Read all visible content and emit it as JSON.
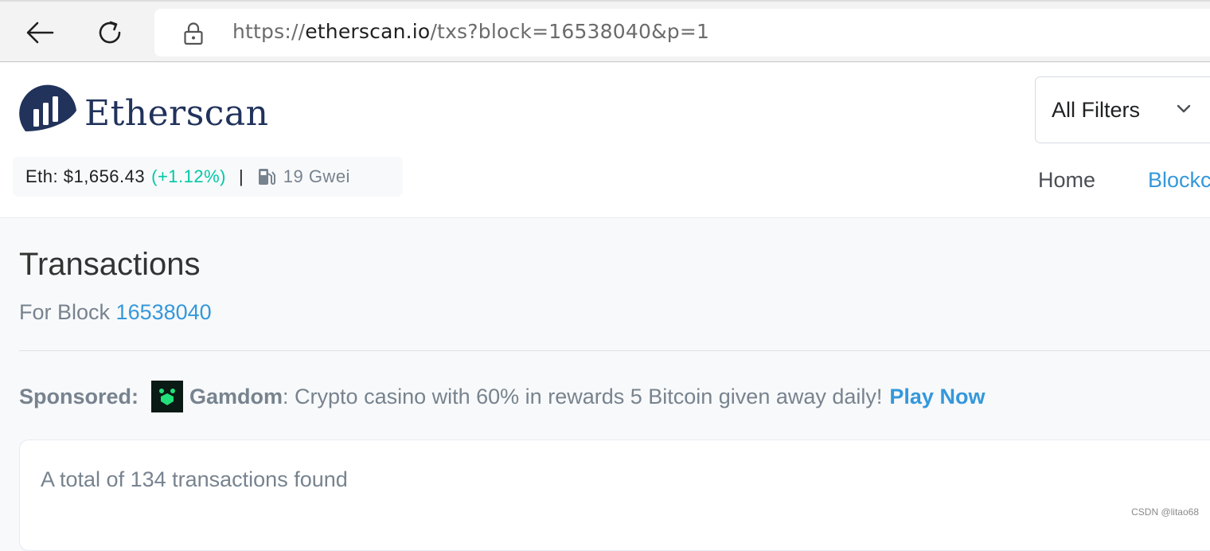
{
  "browser": {
    "url_scheme": "https://",
    "url_host": "etherscan.io",
    "url_path": "/txs?block=16538040&p=1"
  },
  "header": {
    "logo_text": "Etherscan",
    "eth_price_label": "Eth: $1,656.43",
    "eth_price_change": "(+1.12%)",
    "separator": "|",
    "gas_price": "19 Gwei",
    "filter_label": "All Filters",
    "nav": {
      "home": "Home",
      "blockchain": "Blockchain"
    }
  },
  "page": {
    "title": "Transactions",
    "subtitle_prefix": "For Block",
    "block_number": "16538040"
  },
  "sponsored": {
    "label": "Sponsored:",
    "brand": "Gamdom",
    "message": ": Crypto casino with 60% in rewards 5 Bitcoin given away daily!",
    "cta": "Play Now"
  },
  "results": {
    "summary": "A total of 134 transactions found"
  },
  "watermark": "CSDN @litao68",
  "colors": {
    "brand_navy": "#21325b",
    "link_blue": "#3498db",
    "positive_green": "#00c9a7",
    "muted_text": "#77838f"
  }
}
